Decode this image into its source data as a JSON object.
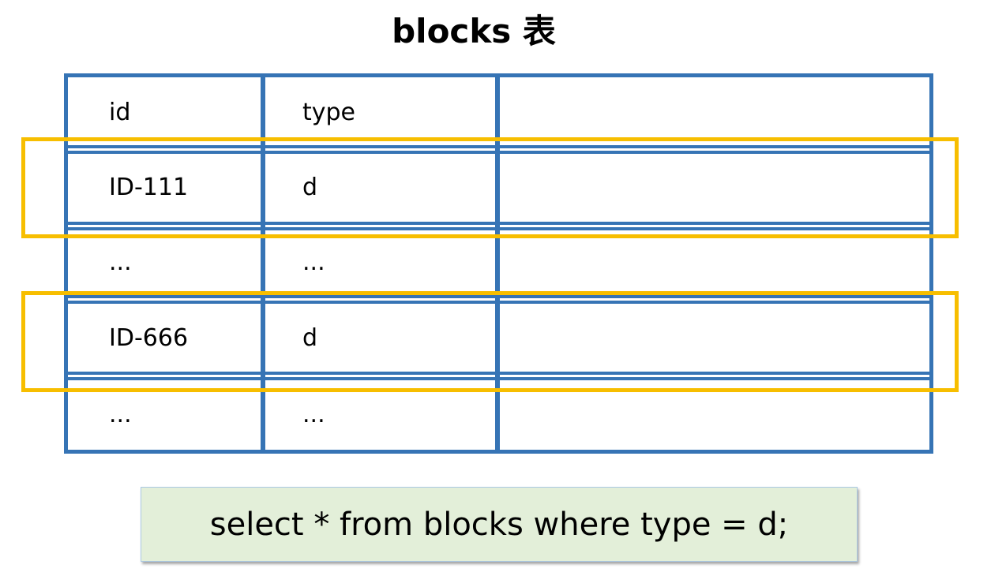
{
  "title": "blocks 表",
  "table": {
    "header": {
      "id": "id",
      "type": "type"
    },
    "rows": [
      {
        "id": "ID-111",
        "type": "d",
        "highlighted": true
      },
      {
        "id": "...",
        "type": "...",
        "highlighted": false
      },
      {
        "id": "ID-666",
        "type": "d",
        "highlighted": true
      },
      {
        "id": "...",
        "type": "...",
        "highlighted": false
      }
    ]
  },
  "query": "select * from blocks where type = d;",
  "colors": {
    "table_border": "#3674b5",
    "highlight": "#f7be00",
    "query_background": "#e3efd9"
  }
}
